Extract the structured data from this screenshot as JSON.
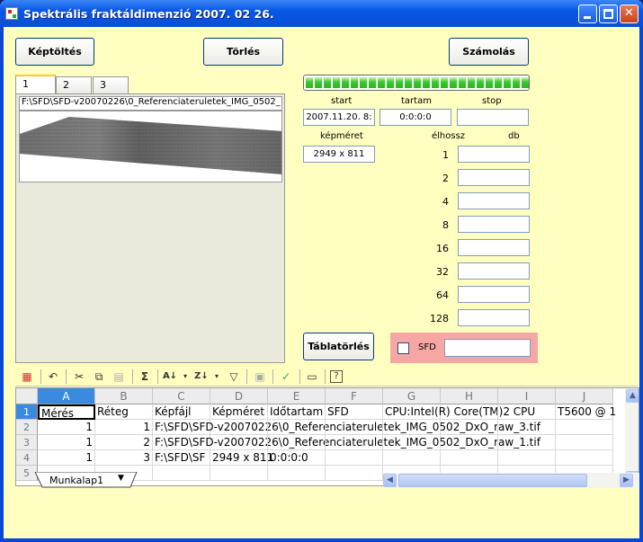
{
  "window": {
    "title": "Spektrális fraktáldimenzió 2007. 02 26."
  },
  "buttons": {
    "load": "Képtöltés",
    "delete": "Törlés",
    "compute": "Számolás",
    "table_clear": "Táblatörlés"
  },
  "progress": {
    "value": 1.0
  },
  "tabs": [
    "1",
    "2",
    "3"
  ],
  "image_panel": {
    "path": "F:\\SFD\\SFD-v20070226\\0_Referenciateruletek_IMG_0502_"
  },
  "fields": {
    "start_label": "start",
    "start_value": "2007.11.20. 8:",
    "duration_label": "tartam",
    "duration_value": "0:0:0:0",
    "stop_label": "stop",
    "stop_value": "",
    "image_size_label": "képméret",
    "image_size_value": "2949 x 811",
    "edge_length_label": "élhossz",
    "count_label": "db"
  },
  "edge_lengths": [
    "1",
    "2",
    "4",
    "8",
    "16",
    "32",
    "64",
    "128"
  ],
  "sfd": {
    "label": "SFD",
    "value": ""
  },
  "sheet": {
    "columns": [
      "A",
      "B",
      "C",
      "D",
      "E",
      "F",
      "G",
      "H",
      "I",
      "J"
    ],
    "rows": [
      [
        "Mérés",
        "Réteg",
        "Képfájl",
        "Képméret",
        "Időtartam",
        "SFD",
        "CPU:Intel(R) Core(TM)2 CPU",
        "",
        "",
        "T5600  @ 1"
      ],
      [
        "1",
        "1",
        "F:\\SFD\\SFD-v20070226\\0_Referenciateruletek_IMG_0502_DxO_raw_3.tif"
      ],
      [
        "1",
        "2",
        "F:\\SFD\\SFD-v20070226\\0_Referenciateruletek_IMG_0502_DxO_raw_1.tif"
      ],
      [
        "1",
        "3",
        "F:\\SFD\\SF",
        "2949 x 811",
        "0:0:0:0"
      ]
    ],
    "row_numbers": [
      "1",
      "2",
      "3",
      "4",
      "5"
    ],
    "tab_name": "Munkalap1"
  }
}
